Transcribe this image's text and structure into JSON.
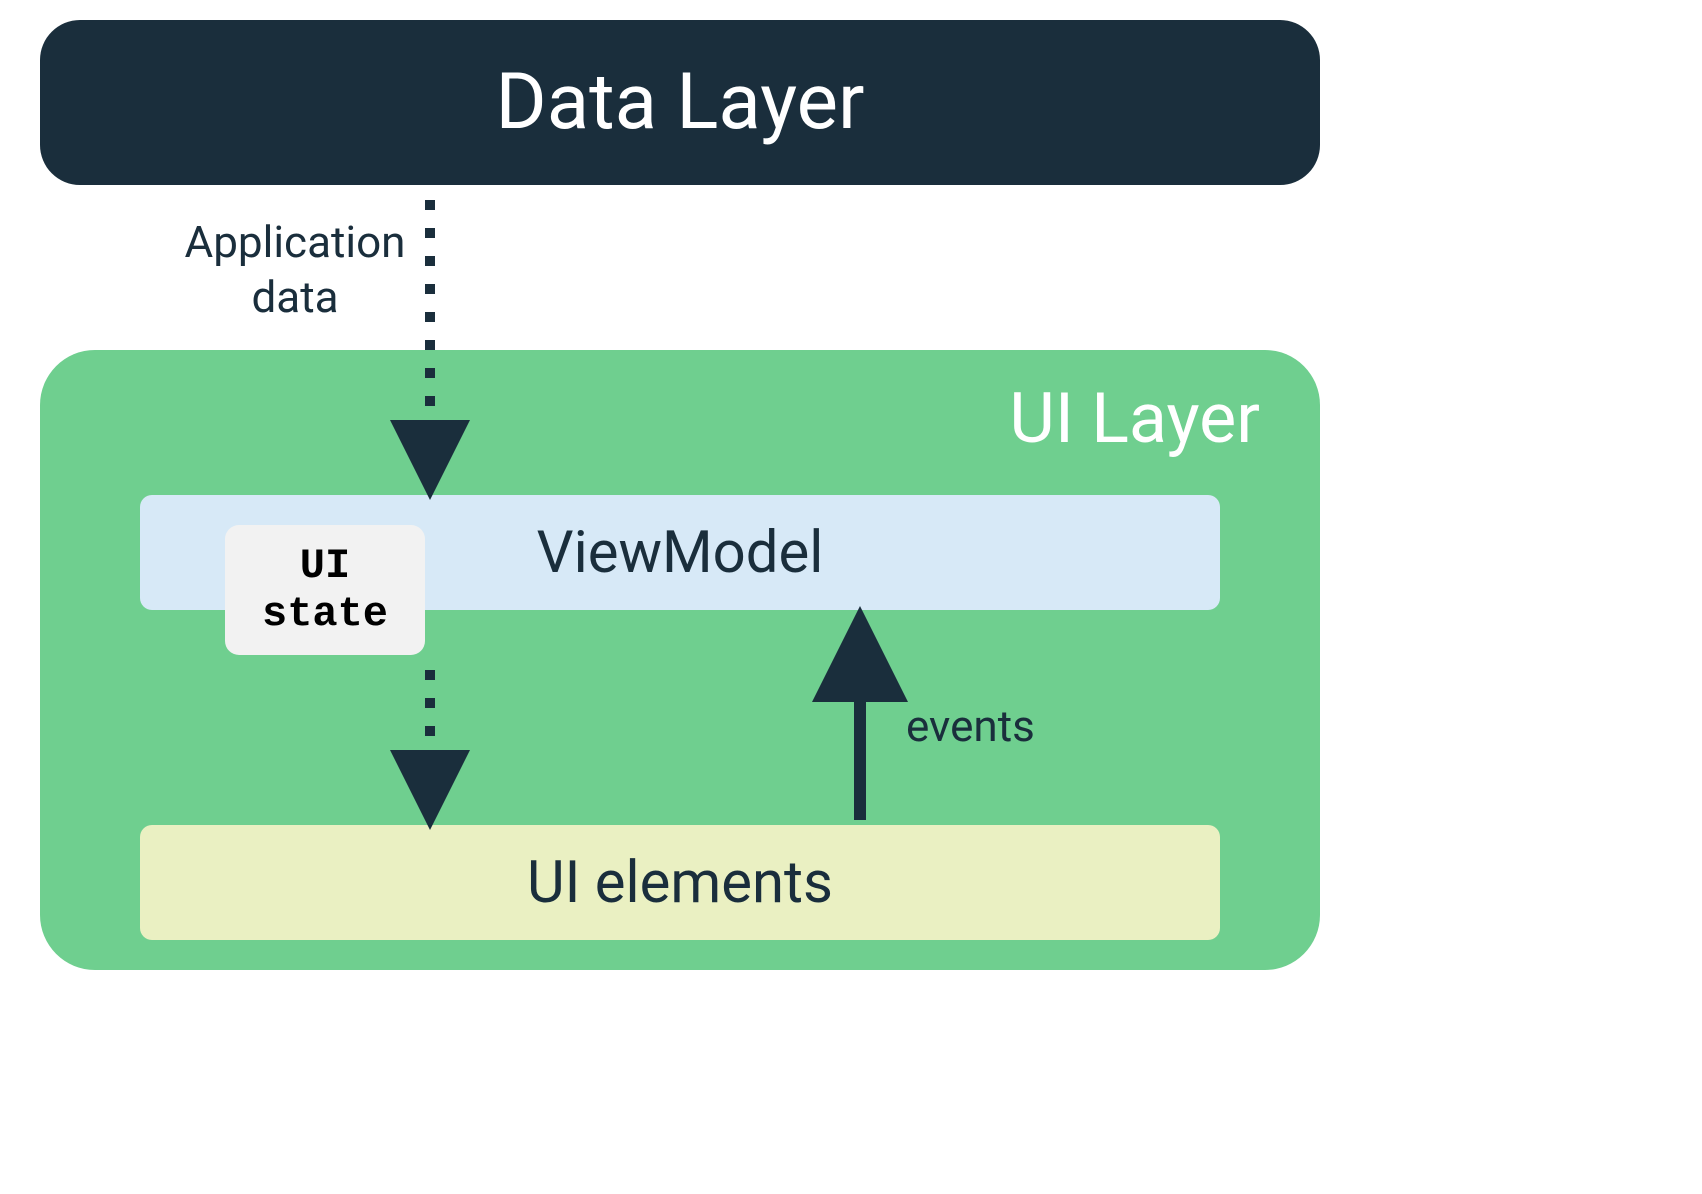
{
  "diagram": {
    "data_layer": {
      "title": "Data Layer"
    },
    "arrows": {
      "application_data_label_line1": "Application",
      "application_data_label_line2": "data",
      "events_label": "events"
    },
    "ui_layer": {
      "title": "UI Layer",
      "viewmodel_label": "ViewModel",
      "ui_state_line1": "UI",
      "ui_state_line2": "state",
      "ui_elements_label": "UI elements"
    },
    "colors": {
      "data_layer_bg": "#1a2e3c",
      "ui_layer_bg": "#6fcf8f",
      "viewmodel_bg": "#d7e9f7",
      "ui_state_bg": "#f2f2f2",
      "ui_elements_bg": "#eaf0c2",
      "arrow_color": "#1a2e3c"
    }
  }
}
